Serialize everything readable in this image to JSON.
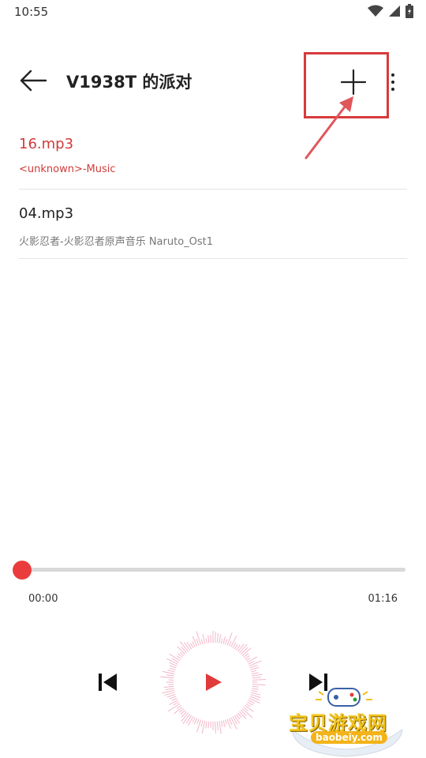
{
  "status_bar": {
    "time": "10:55",
    "icons": [
      "wifi-icon",
      "signal-icon",
      "battery-icon"
    ]
  },
  "header": {
    "title": "V1938T 的派对",
    "back_icon": "back-arrow-icon",
    "add_icon": "plus-icon",
    "more_icon": "more-vert-icon"
  },
  "songs": [
    {
      "title": "16.mp3",
      "subtitle": "<unknown>-Music",
      "active": true
    },
    {
      "title": "04.mp3",
      "subtitle": "火影忍者-火影忍者原声音乐 Naruto_Ost1",
      "active": false
    }
  ],
  "player": {
    "current_time": "00:00",
    "total_time": "01:16",
    "progress": 0.0,
    "prev_icon": "skip-previous-icon",
    "play_icon": "play-icon",
    "next_icon": "skip-next-icon"
  },
  "watermark": {
    "text": "宝贝游戏网",
    "url": "baobeiy.com"
  },
  "colors": {
    "accent": "#e23a3a",
    "annotation": "#d83a3a",
    "track": "#d9d9d9",
    "divider": "#e4e4e4"
  }
}
